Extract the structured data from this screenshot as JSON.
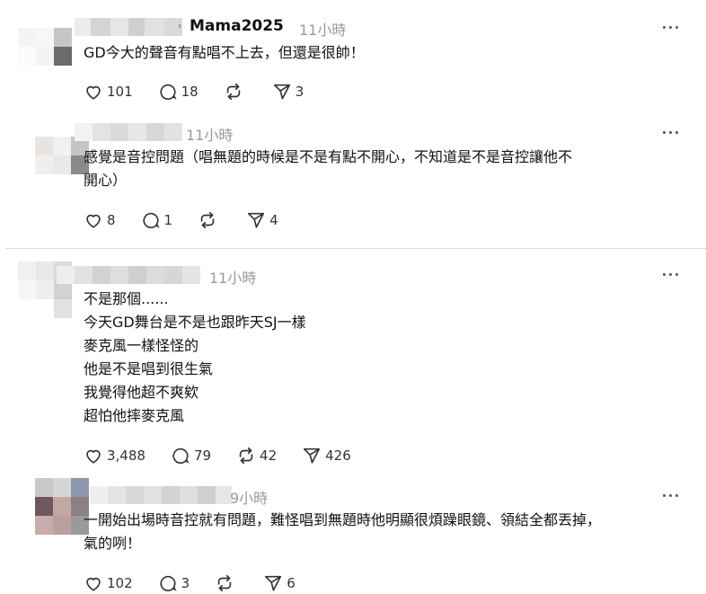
{
  "comments": [
    {
      "username": "Mama2025",
      "time": "11小時",
      "text": "GD今大的聲音有點唱不上去，但還是很帥！",
      "likes": "101",
      "replies": "18",
      "reposts": "",
      "shares": "3"
    },
    {
      "username": "",
      "time": "11小時",
      "text": "感覺是音控問題（唱無題的時候是不是有點不開心，不知道是不是音控讓他不\n開心）",
      "likes": "8",
      "replies": "1",
      "reposts": "",
      "shares": "4"
    },
    {
      "username": "",
      "time": "11小時",
      "text": "不是那個......\n今天GD舞台是不是也跟昨天SJ一樣\n麥克風一樣怪怪的\n他是不是唱到很生氣\n我覺得他超不爽欸\n超怕他摔麥克風",
      "likes": "3,488",
      "replies": "79",
      "reposts": "42",
      "shares": "426"
    },
    {
      "username": "",
      "time": "9小時",
      "text": "一開始出場時音控就有問題，難怪唱到無題時他明顯很煩躁眼鏡、領結全都丟掉，\n氣的咧！",
      "likes": "102",
      "replies": "3",
      "reposts": "",
      "shares": "6"
    }
  ],
  "icons": {
    "like": "heart-icon",
    "reply": "comment-icon",
    "repost": "repost-icon",
    "share": "send-icon",
    "more": "more-icon"
  },
  "colors": {
    "text": "#111111",
    "muted": "#999999",
    "separator": "#d9d9d9"
  }
}
